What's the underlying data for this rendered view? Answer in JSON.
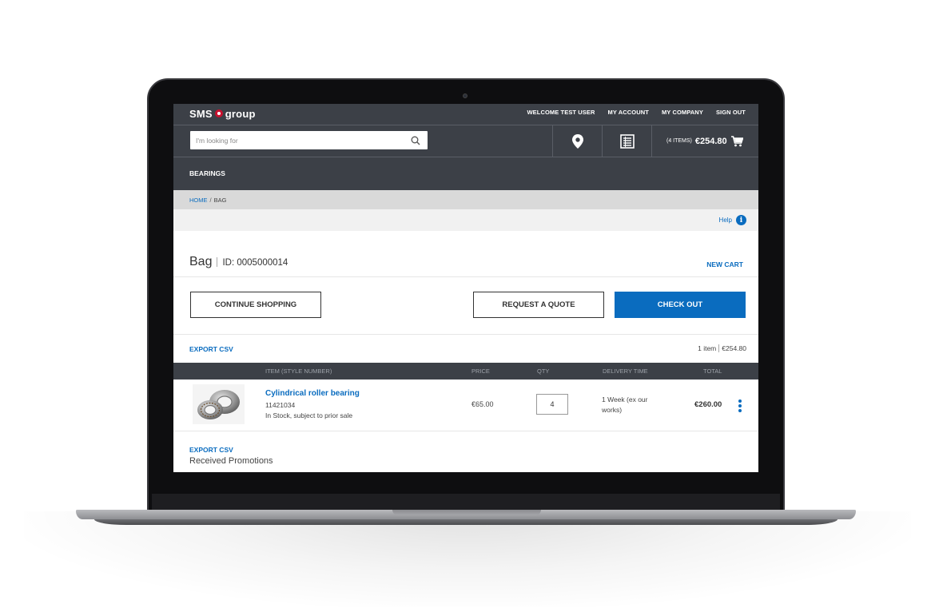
{
  "brand": {
    "logo_left": "SMS",
    "logo_right": "group"
  },
  "header": {
    "links": [
      "WELCOME TEST USER",
      "MY ACCOUNT",
      "MY COMPANY",
      "SIGN OUT"
    ],
    "search_placeholder": "I'm looking for",
    "cart": {
      "items_label": "(4 ITEMS)",
      "total": "€254.80"
    }
  },
  "nav": {
    "category": "BEARINGS"
  },
  "breadcrumb": {
    "home": "HOME",
    "separator": "/",
    "current": "BAG"
  },
  "help": {
    "label": "Help"
  },
  "bag": {
    "title": "Bag",
    "id_label": "ID: 0005000014",
    "new_cart": "NEW CART",
    "continue_shopping": "CONTINUE SHOPPING",
    "request_quote": "REQUEST A QUOTE",
    "checkout": "CHECK OUT",
    "export_csv": "EXPORT CSV",
    "summary_items": "1 item",
    "summary_total": "€254.80"
  },
  "table": {
    "headers": {
      "item": "ITEM (STYLE NUMBER)",
      "price": "PRICE",
      "qty": "QTY",
      "delivery": "DELIVERY TIME",
      "total": "TOTAL"
    },
    "rows": [
      {
        "name": "Cylindrical roller bearing",
        "sku": "11421034",
        "stock": "In Stock, subject to prior sale",
        "price": "€65.00",
        "qty": "4",
        "delivery": "1  Week (ex our works)",
        "total": "€260.00"
      }
    ]
  },
  "footer": {
    "export_csv": "EXPORT CSV",
    "promotions": "Received Promotions"
  },
  "colors": {
    "header_bg": "#3c4047",
    "accent": "#0a6cbf",
    "breadcrumb_bg": "#d9d9d9",
    "brand_red": "#c8102e"
  },
  "icons": [
    "search-icon",
    "location-pin-icon",
    "order-list-icon",
    "cart-icon",
    "info-icon",
    "more-vertical-icon",
    "bearing-thumbnail"
  ]
}
